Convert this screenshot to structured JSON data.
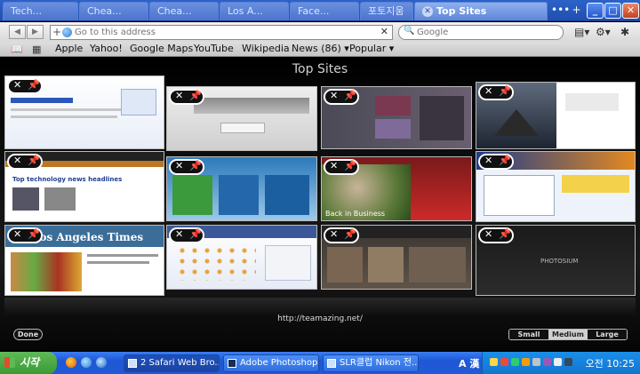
{
  "window": {
    "tabs": [
      {
        "label": "Tech..."
      },
      {
        "label": "Chea..."
      },
      {
        "label": "Chea..."
      },
      {
        "label": "Los A..."
      },
      {
        "label": "Face..."
      },
      {
        "label": "포토지움"
      },
      {
        "label": "Top Sites",
        "active": true
      }
    ],
    "tab_overflow_icon": "overflow-dots-icon",
    "new_tab_label": "+",
    "minimize_label": "_",
    "maximize_label": "□",
    "close_label": "✕"
  },
  "toolbar": {
    "back_label": "◀",
    "forward_label": "▶",
    "address_placeholder": "Go to this address",
    "search_placeholder": "Google",
    "page_menu_icon": "page-menu-icon",
    "settings_icon": "gear-icon",
    "bug_icon": "bug-report-icon"
  },
  "bookmarks": {
    "items": [
      {
        "label": "Apple"
      },
      {
        "label": "Yahoo!"
      },
      {
        "label": "Google Maps"
      },
      {
        "label": "YouTube"
      },
      {
        "label": "Wikipedia"
      },
      {
        "label": "News (86) ▾"
      },
      {
        "label": "Popular ▾"
      }
    ]
  },
  "top_sites": {
    "title": "Top Sites",
    "footer_url": "http://teamazing.net/",
    "done_label": "Done",
    "sizes": [
      {
        "label": "Small"
      },
      {
        "label": "Medium",
        "active": true
      },
      {
        "label": "Large"
      }
    ],
    "thumbnails": [
      {
        "name": "site-1",
        "pinned": false
      },
      {
        "name": "site-2",
        "pinned": false
      },
      {
        "name": "site-3",
        "pinned": false
      },
      {
        "name": "site-4",
        "pinned": true
      },
      {
        "name": "site-5",
        "headline": "Top technology news headlines",
        "pinned": false
      },
      {
        "name": "site-6",
        "pinned": false
      },
      {
        "name": "site-7",
        "caption": "Back in Business",
        "pinned": false
      },
      {
        "name": "site-8",
        "pinned": false
      },
      {
        "name": "site-9",
        "headline": "Los Angeles Times",
        "pinned": false
      },
      {
        "name": "site-10",
        "pinned": false
      },
      {
        "name": "site-11",
        "pinned": false
      },
      {
        "name": "site-12",
        "headline": "PHOTOSIUM",
        "pinned": false
      }
    ]
  },
  "taskbar": {
    "start_label": "시작",
    "tasks": [
      {
        "label": "2 Safari Web Bro..."
      },
      {
        "label": "Adobe Photoshop ..."
      },
      {
        "label": "SLR클럽 Nikon 전..."
      }
    ],
    "ime_label": "A 漢",
    "clock": "오전 10:25"
  }
}
